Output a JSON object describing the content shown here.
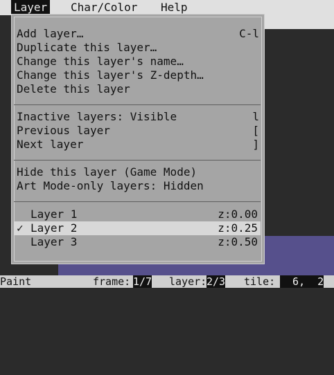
{
  "menubar": {
    "items": [
      {
        "label": "Layer",
        "active": true
      },
      {
        "label": "Char/Color",
        "active": false
      },
      {
        "label": "Help",
        "active": false
      }
    ]
  },
  "layer_menu": {
    "group1": [
      {
        "label": "Add layer…",
        "shortcut": "C-l"
      },
      {
        "label": "Duplicate this layer…",
        "shortcut": ""
      },
      {
        "label": "Change this layer's name…",
        "shortcut": ""
      },
      {
        "label": "Change this layer's Z-depth…",
        "shortcut": ""
      },
      {
        "label": "Delete this layer",
        "shortcut": ""
      }
    ],
    "group2": [
      {
        "label": "Inactive layers: Visible",
        "shortcut": "l"
      },
      {
        "label": "Previous layer",
        "shortcut": "["
      },
      {
        "label": "Next layer",
        "shortcut": "]"
      }
    ],
    "group3": [
      {
        "label": "Hide this layer (Game Mode)",
        "shortcut": ""
      },
      {
        "label": "Art Mode-only layers: Hidden",
        "shortcut": ""
      }
    ],
    "layers": [
      {
        "check": "",
        "name": "Layer 1",
        "z": "z:0.00"
      },
      {
        "check": "✓",
        "name": "Layer 2",
        "z": "z:0.25"
      },
      {
        "check": "",
        "name": "Layer 3",
        "z": "z:0.50"
      }
    ]
  },
  "statusbar": {
    "mode": "Paint",
    "frame_label": "frame:",
    "frame_value": "1/7",
    "layer_label": "layer:",
    "layer_value": "2/3",
    "tile_label": "tile:",
    "tile_value": "  6,  2"
  },
  "colors": {
    "menu_bg": "#a5a5a5",
    "menubar_bg": "#e0e0e0",
    "canvas_accent": "#56508c"
  }
}
